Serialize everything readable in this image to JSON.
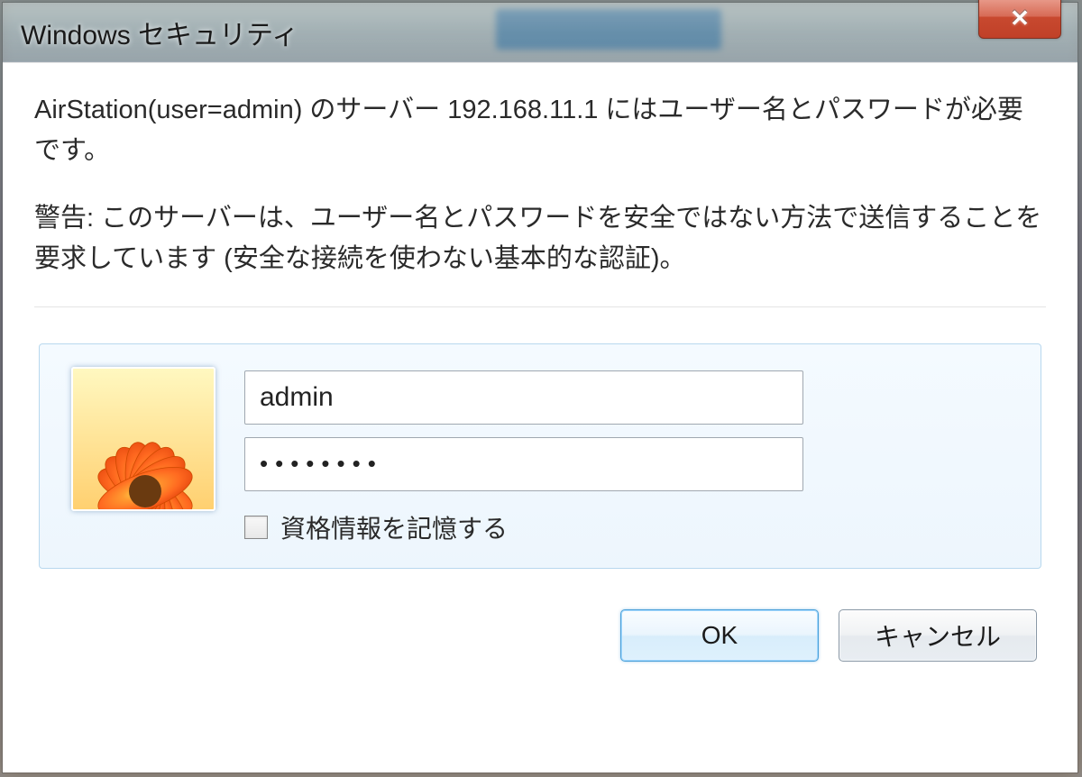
{
  "dialog": {
    "title": "Windows セキュリティ",
    "message": "AirStation(user=admin) のサーバー 192.168.11.1 にはユーザー名とパスワードが必要です。",
    "warning": "警告: このサーバーは、ユーザー名とパスワードを安全ではない方法で送信することを要求しています (安全な接続を使わない基本的な認証)。",
    "credentials": {
      "username_value": "admin",
      "password_value": "••••••••",
      "remember_label": "資格情報を記憶する",
      "remember_checked": false
    },
    "buttons": {
      "ok": "OK",
      "cancel": "キャンセル"
    },
    "icons": {
      "close": "close-icon",
      "avatar": "flower-avatar"
    },
    "colors": {
      "close_button": "#c8492f",
      "credential_box_bg": "#edf6fd",
      "credential_box_border": "#b8d8ee",
      "default_button_border": "#4aa0d8"
    }
  }
}
